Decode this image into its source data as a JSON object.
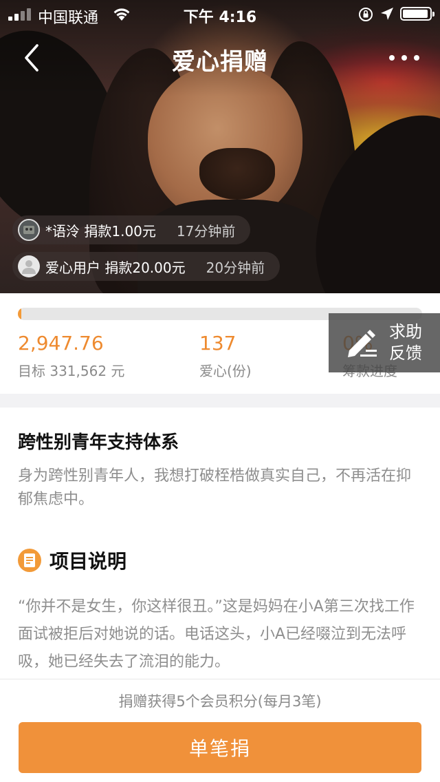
{
  "status_bar": {
    "carrier": "中国联通",
    "time": "下午 4:16",
    "battery_level": 0.95,
    "signal_bars": 2,
    "icons": [
      "signal-icon",
      "wifi-icon",
      "orientation-lock-icon",
      "location-icon",
      "battery-icon"
    ]
  },
  "nav": {
    "title": "爱心捐赠",
    "back_icon": "back-chevron-icon",
    "more_icon": "more-dots-icon"
  },
  "donations": [
    {
      "user": "*语泠",
      "action": "捐款1.00元",
      "ago": "17分钟前",
      "avatar": "user-photo-avatar"
    },
    {
      "user": "爱心用户",
      "action": "捐款20.00元",
      "ago": "20分钟前",
      "avatar": "default-user-avatar"
    }
  ],
  "progress": {
    "fraction": 0.009,
    "raised": "2,947.76",
    "target_label": "目标 331,562 元",
    "hearts": "137",
    "hearts_label": "爱心(份)",
    "percent": "0%",
    "percent_label": "筹款进度"
  },
  "help_button": {
    "line1": "求助",
    "line2": "反馈",
    "icon": "edit-pencil-icon"
  },
  "project": {
    "title": "跨性别青年支持体系",
    "subtitle": "身为跨性别青年人，我想打破桎梏做真实自己，不再活在抑郁焦虑中。",
    "section_title": "项目说明",
    "section_icon": "document-icon",
    "description": "“你并不是女生，你这样很丑。”这是妈妈在小A第三次找工作面试被拒后对她说的话。电话这头，小A已经啜泣到无法呼吸，她已经失去了流泪的能力。"
  },
  "footer": {
    "note": "捐赠获得5个会员积分(每月3笔)",
    "button": "单笔捐"
  },
  "colors": {
    "accent": "#f0913a",
    "accent_text": "#ee8a2f",
    "muted": "#8e8e8e"
  }
}
